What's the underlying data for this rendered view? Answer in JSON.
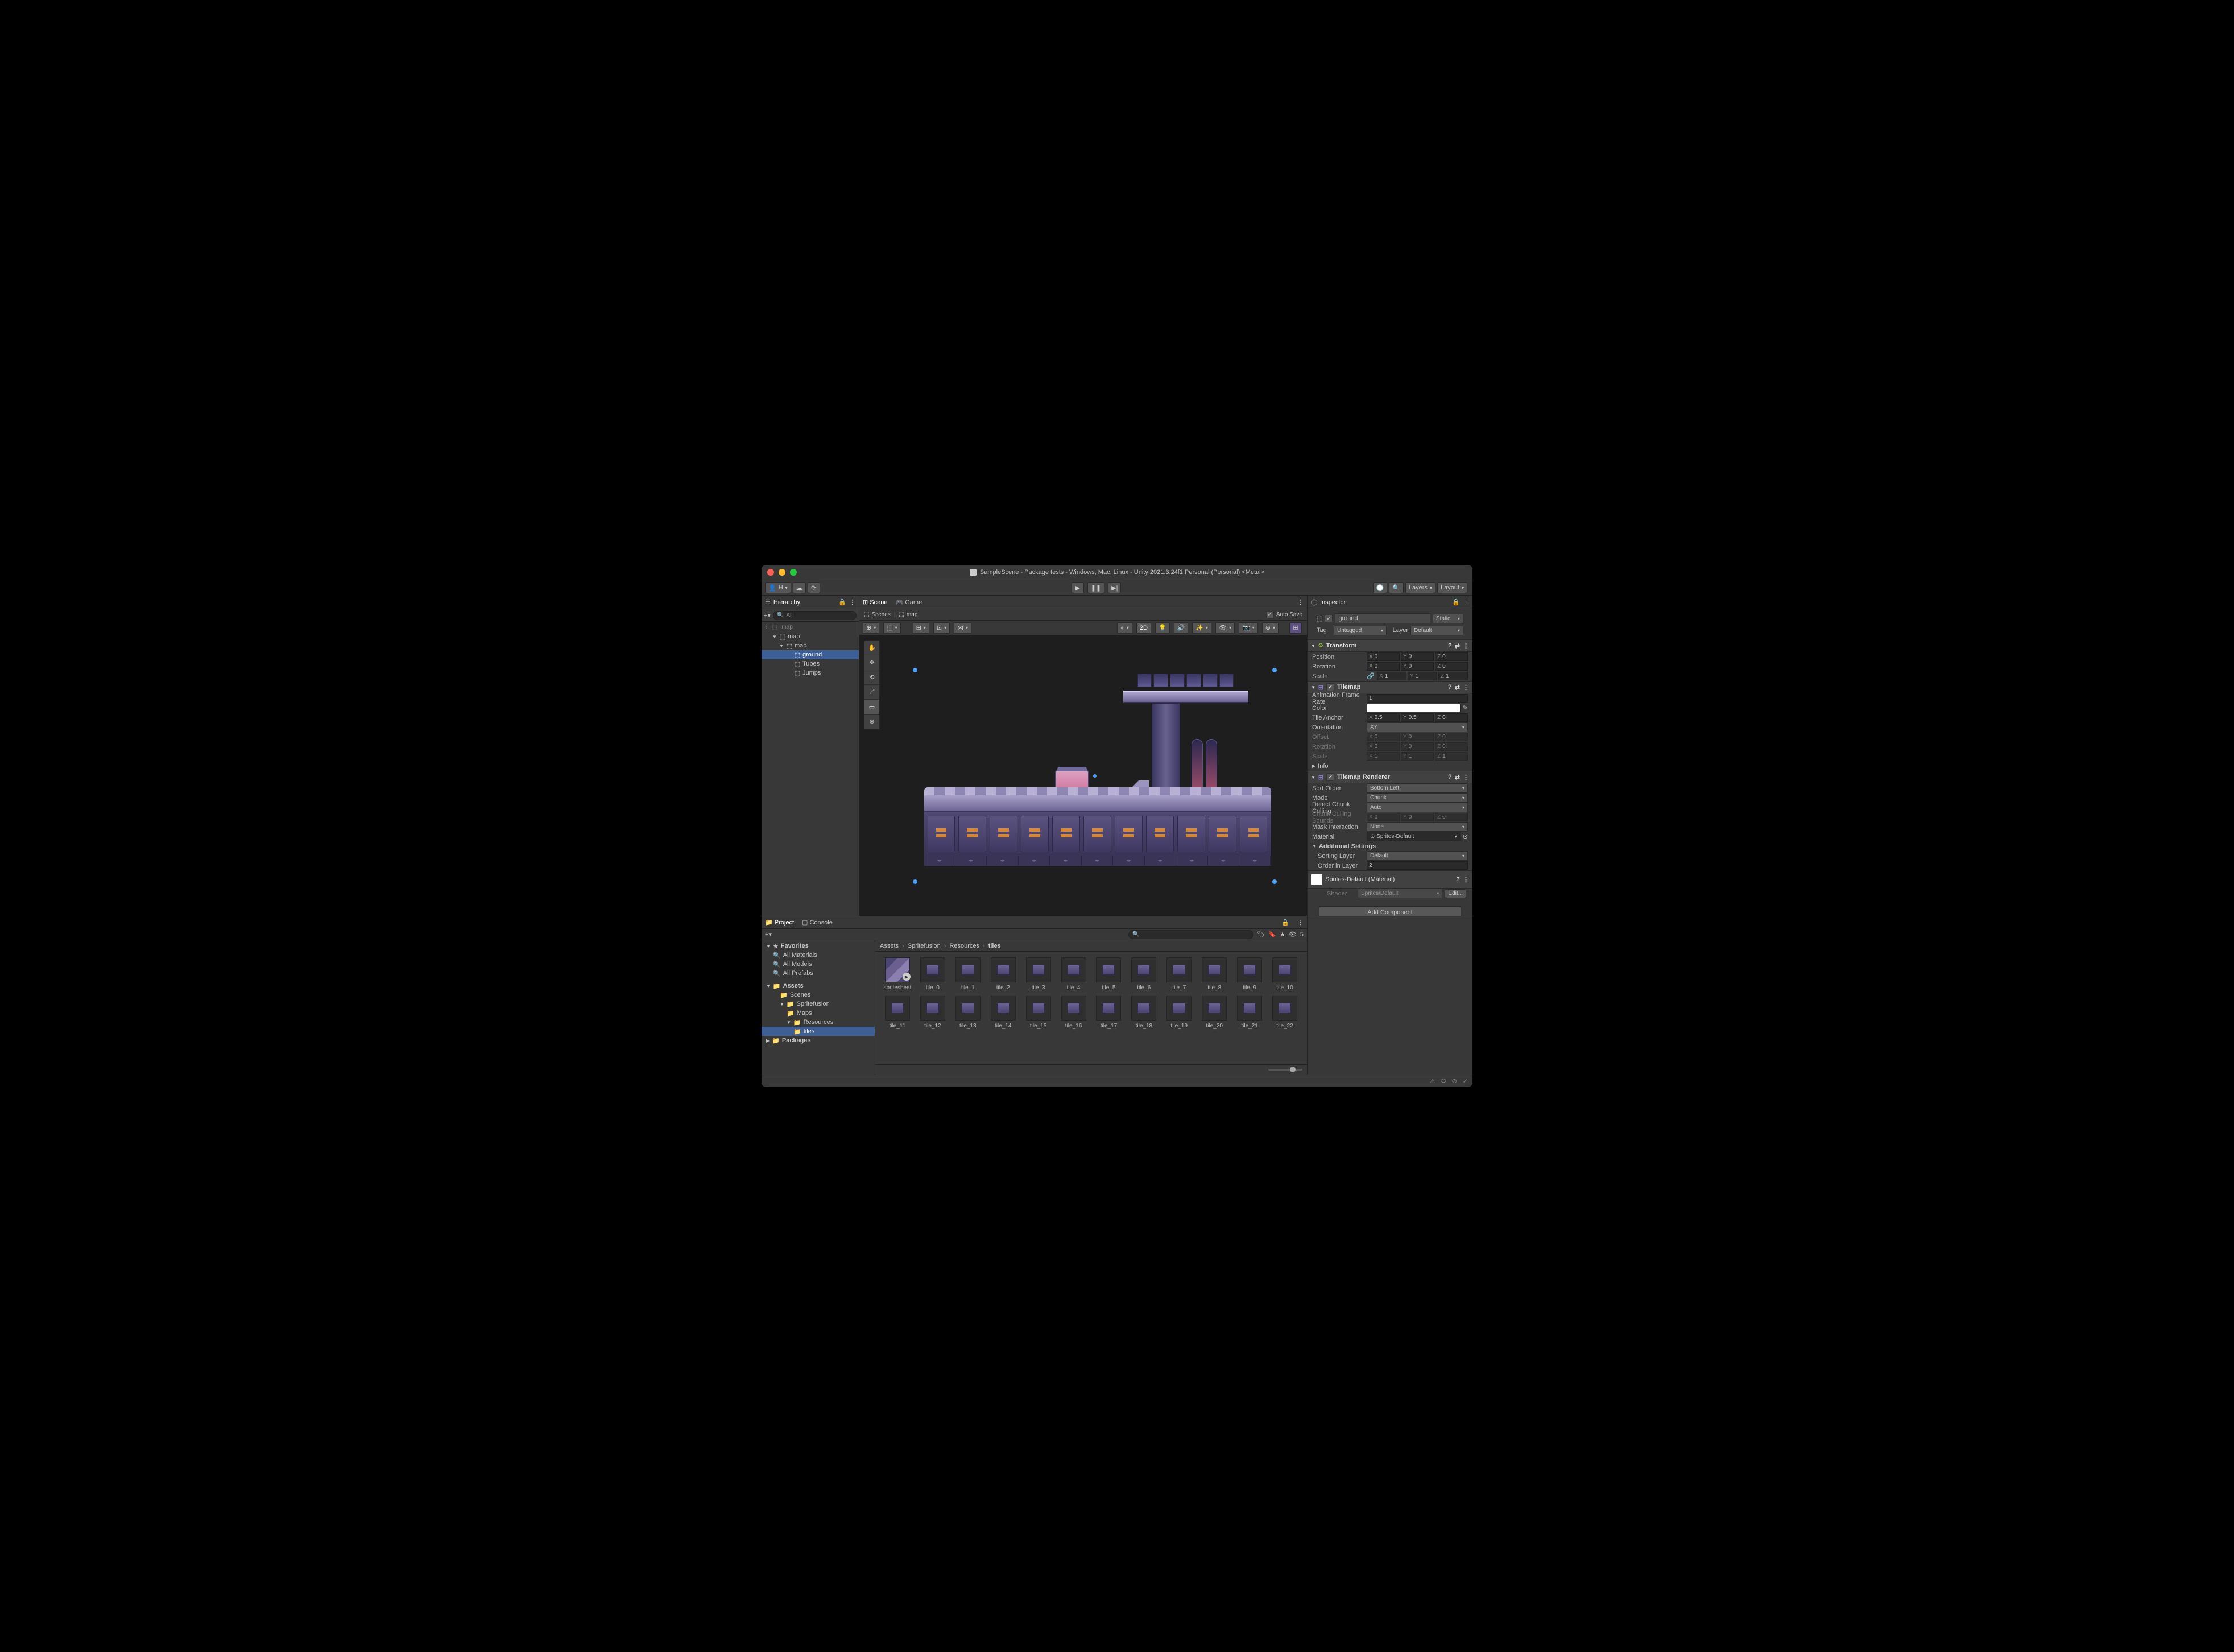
{
  "window": {
    "title": "SampleScene - Package tests - Windows, Mac, Linux - Unity 2021.3.24f1 Personal (Personal) <Metal>"
  },
  "toolbar": {
    "account_label": "H",
    "layers_label": "Layers",
    "layout_label": "Layout"
  },
  "hierarchy": {
    "title": "Hierarchy",
    "search_placeholder": "All",
    "scene_root": "map",
    "items": [
      {
        "label": "map",
        "depth": 1,
        "expanded": true
      },
      {
        "label": "map",
        "depth": 2,
        "expanded": true
      },
      {
        "label": "ground",
        "depth": 3,
        "selected": true
      },
      {
        "label": "Tubes",
        "depth": 3
      },
      {
        "label": "Jumps",
        "depth": 3
      }
    ]
  },
  "scene": {
    "tab_scene": "Scene",
    "tab_game": "Game",
    "breadcrumb_scenes": "Scenes",
    "breadcrumb_current": "map",
    "auto_save": "Auto Save",
    "mode_2d": "2D"
  },
  "inspector": {
    "title": "Inspector",
    "object_name": "ground",
    "static_label": "Static",
    "tag_label": "Tag",
    "tag_value": "Untagged",
    "layer_label": "Layer",
    "layer_value": "Default",
    "transform": {
      "title": "Transform",
      "position_label": "Position",
      "rotation_label": "Rotation",
      "scale_label": "Scale",
      "position": {
        "x": "0",
        "y": "0",
        "z": "0"
      },
      "rotation": {
        "x": "0",
        "y": "0",
        "z": "0"
      },
      "scale": {
        "x": "1",
        "y": "1",
        "z": "1"
      }
    },
    "tilemap": {
      "title": "Tilemap",
      "frame_rate_label": "Animation Frame Rate",
      "frame_rate": "1",
      "color_label": "Color",
      "anchor_label": "Tile Anchor",
      "anchor": {
        "x": "0.5",
        "y": "0.5",
        "z": "0"
      },
      "orientation_label": "Orientation",
      "orientation": "XY",
      "offset_label": "Offset",
      "offset": {
        "x": "0",
        "y": "0",
        "z": "0"
      },
      "rotation_label": "Rotation",
      "rotation": {
        "x": "0",
        "y": "0",
        "z": "0"
      },
      "scale_label": "Scale",
      "scale": {
        "x": "1",
        "y": "1",
        "z": "1"
      },
      "info_label": "Info"
    },
    "renderer": {
      "title": "Tilemap Renderer",
      "sort_order_label": "Sort Order",
      "sort_order": "Bottom Left",
      "mode_label": "Mode",
      "mode": "Chunk",
      "detect_label": "Detect Chunk Culling",
      "detect": "Auto",
      "bounds_label": "Chunk Culling Bounds",
      "bounds": {
        "x": "0",
        "y": "0",
        "z": "0"
      },
      "mask_label": "Mask Interaction",
      "mask": "None",
      "material_label": "Material",
      "material": "Sprites-Default",
      "additional_label": "Additional Settings",
      "sorting_layer_label": "Sorting Layer",
      "sorting_layer": "Default",
      "order_label": "Order in Layer",
      "order": "2"
    },
    "material_section": {
      "title": "Sprites-Default (Material)",
      "shader_label": "Shader",
      "shader": "Sprites/Default",
      "edit_label": "Edit..."
    },
    "add_component": "Add Component"
  },
  "project": {
    "tab_project": "Project",
    "tab_console": "Console",
    "visible_count": "5",
    "favorites_label": "Favorites",
    "favorites": [
      "All Materials",
      "All Models",
      "All Prefabs"
    ],
    "assets_label": "Assets",
    "folders": [
      {
        "label": "Scenes",
        "depth": 2
      },
      {
        "label": "Spritefusion",
        "depth": 2,
        "expanded": true
      },
      {
        "label": "Maps",
        "depth": 3
      },
      {
        "label": "Resources",
        "depth": 3,
        "expanded": true
      },
      {
        "label": "tiles",
        "depth": 4,
        "selected": true
      }
    ],
    "packages_label": "Packages",
    "breadcrumb": [
      "Assets",
      "Spritefusion",
      "Resources",
      "tiles"
    ],
    "assets": [
      "spritesheet",
      "tile_0",
      "tile_1",
      "tile_2",
      "tile_3",
      "tile_4",
      "tile_5",
      "tile_6",
      "tile_7",
      "tile_8",
      "tile_9",
      "tile_10",
      "tile_11",
      "tile_12",
      "tile_13",
      "tile_14",
      "tile_15",
      "tile_16",
      "tile_17",
      "tile_18",
      "tile_19",
      "tile_20",
      "tile_21",
      "tile_22"
    ]
  }
}
